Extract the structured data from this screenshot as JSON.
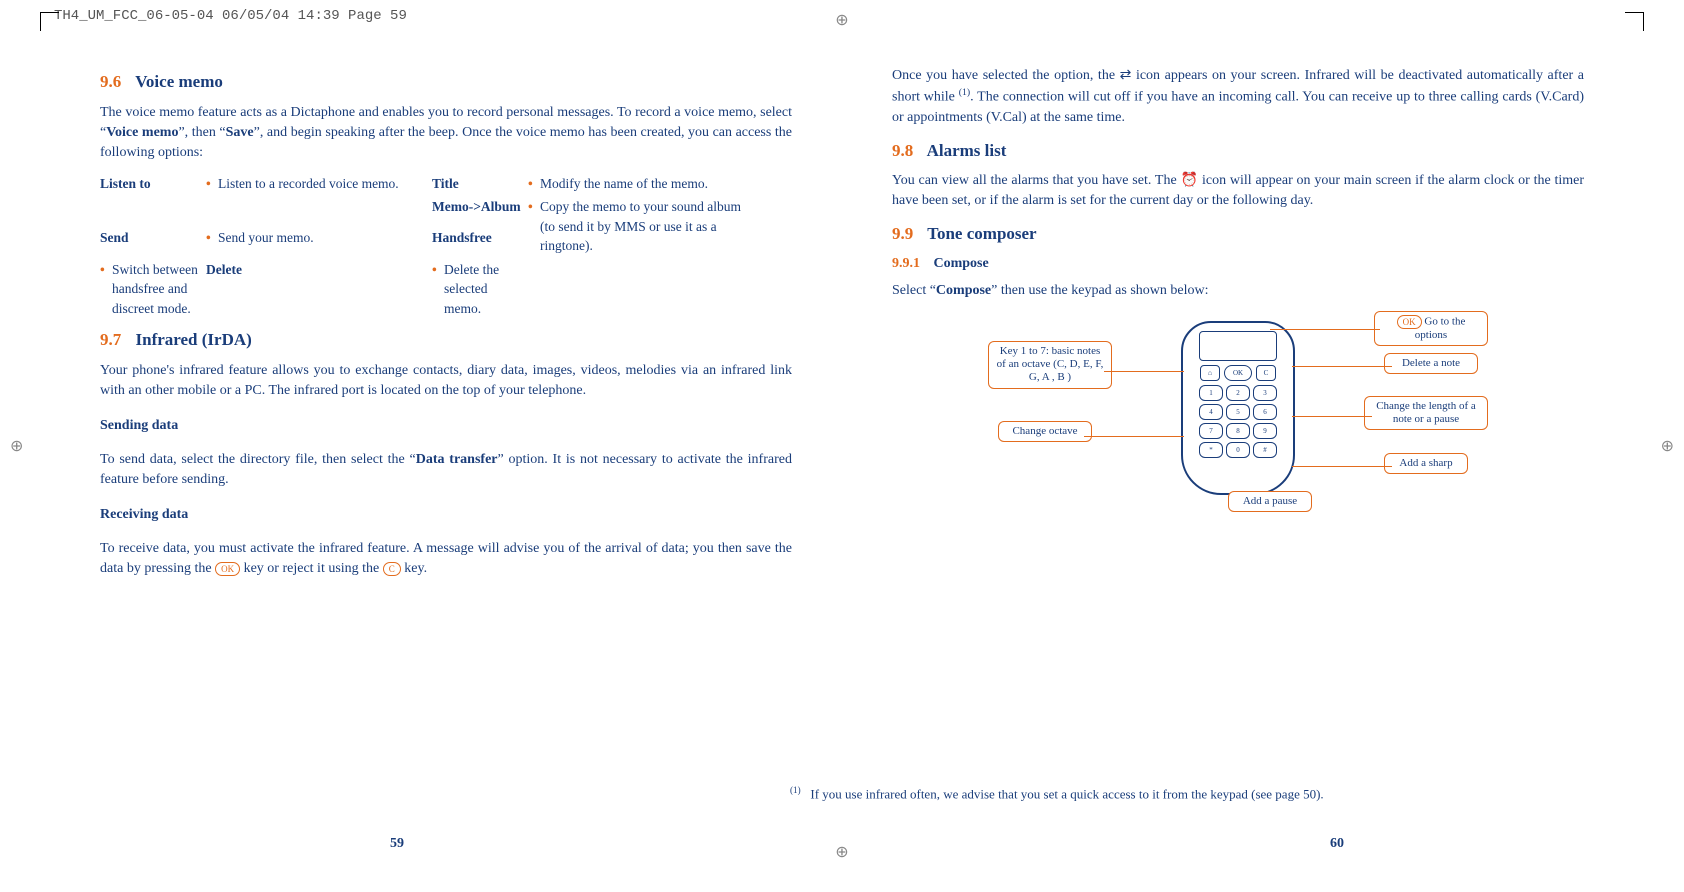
{
  "print_header": "TH4_UM_FCC_06-05-04  06/05/04  14:39  Page 59",
  "left": {
    "s96_num": "9.6",
    "s96_title": "Voice memo",
    "s96_body": "The voice memo feature acts as a Dictaphone and enables you to record personal messages. To record a voice memo, select “",
    "s96_body_bold1": "Voice memo",
    "s96_body_mid": "”, then “",
    "s96_body_bold2": "Save",
    "s96_body_end": "”, and begin speaking after the beep. Once the voice memo has been created, you can access the following options:",
    "options": {
      "listen_to": {
        "term": "Listen to",
        "def": "Listen to a recorded voice memo."
      },
      "send": {
        "term": "Send",
        "def": "Send your memo."
      },
      "handsfree": {
        "term": "Handsfree",
        "def": "Switch between handsfree and discreet mode."
      },
      "title": {
        "term": "Title",
        "def": "Modify the name of the memo."
      },
      "memo_album": {
        "term": "Memo->Album",
        "def": "Copy the memo to your sound album (to send it by MMS or use it as a ringtone)."
      },
      "delete": {
        "term": "Delete",
        "def": "Delete the selected memo."
      }
    },
    "s97_num": "9.7",
    "s97_title": "Infrared (IrDA)",
    "s97_body": "Your phone's infrared feature allows you to exchange contacts, diary data, images, videos, melodies via an infrared link with an other mobile or a PC. The infrared port is located on the top of your telephone.",
    "sending_h": "Sending data",
    "sending_body_a": "To send data, select the directory file, then select the “",
    "sending_body_bold": "Data transfer",
    "sending_body_b": "” option. It is not necessary to activate the infrared feature before sending.",
    "receiving_h": "Receiving data",
    "receiving_body_a": "To receive data, you must activate the infrared feature. A message will advise you of the arrival of data; you then save the data by pressing the ",
    "receiving_ok": "OK",
    "receiving_body_b": " key or reject it using the ",
    "receiving_c": "C",
    "receiving_body_c": " key.",
    "pagenum": "59"
  },
  "right": {
    "intro_a": "Once you have selected the option, the ",
    "intro_b": " icon appears on your screen. Infrared will be deactivated automatically after a short while ",
    "intro_sup": "(1)",
    "intro_c": ". The connection will cut off if you have an incoming call. You can receive up to three calling cards (V.Card) or appointments (V.Cal) at the same time.",
    "s98_num": "9.8",
    "s98_title": "Alarms list",
    "s98_body_a": "You can view all the alarms that you have set. The ",
    "s98_body_b": " icon will appear on your main screen if the alarm clock or the timer have been set, or if the alarm is set for the current day or the following day.",
    "s99_num": "9.9",
    "s99_title": "Tone composer",
    "s991_num": "9.9.1",
    "s991_title": "Compose",
    "s991_body_a": "Select “",
    "s991_body_bold": "Compose",
    "s991_body_b": "” then use the keypad as shown below:",
    "callouts": {
      "options_ok": "OK",
      "options": "Go to the options",
      "delete": "Delete a note",
      "change_len": "Change the length of a note or a pause",
      "add_sharp": "Add a sharp",
      "add_pause": "Add a pause",
      "change_octave": "Change octave",
      "keys17": "Key 1 to 7: basic notes of an octave (C, D, E, F, G, A , B )"
    },
    "footnote_sup": "(1)",
    "footnote": "If you use infrared often, we advise that you set a quick access to it from the keypad (see page 50).",
    "pagenum": "60"
  }
}
